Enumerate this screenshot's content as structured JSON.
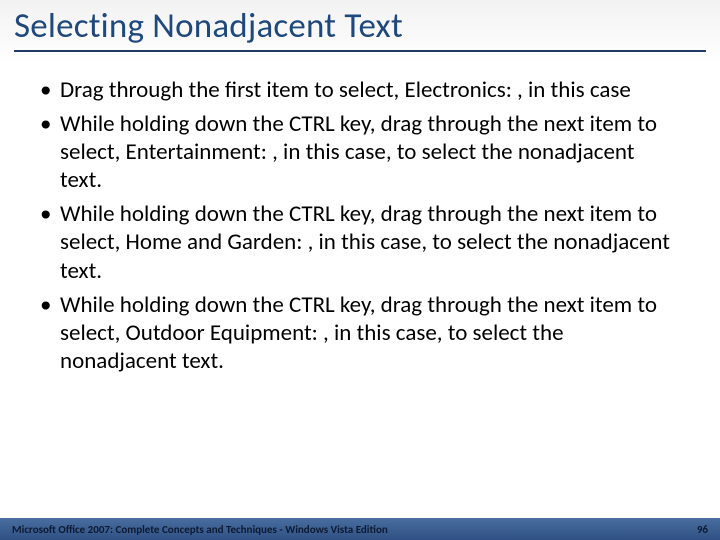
{
  "title": "Selecting Nonadjacent Text",
  "bullets": [
    "Drag through the first item to select, Electronics: , in this case",
    "While holding down the CTRL key, drag through the next item to select, Entertainment: , in this case, to select the nonadjacent text.",
    "While holding down the CTRL key, drag through the next item to select, Home and Garden: , in this case, to select the nonadjacent text.",
    "While holding down the CTRL key, drag through the next item to select, Outdoor Equipment: , in this case, to select the nonadjacent text."
  ],
  "footer": {
    "left": "Microsoft Office 2007: Complete Concepts and Techniques - Windows Vista Edition",
    "page": "96"
  }
}
